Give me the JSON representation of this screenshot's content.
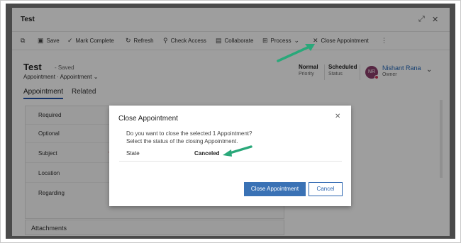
{
  "window": {
    "title": "Test"
  },
  "command_bar": {
    "items": [
      {
        "label": "Save",
        "icon": "save-icon"
      },
      {
        "label": "Mark Complete",
        "icon": "checkmark-icon"
      },
      {
        "label": "Refresh",
        "icon": "refresh-icon"
      },
      {
        "label": "Check Access",
        "icon": "key-person-icon"
      },
      {
        "label": "Collaborate",
        "icon": "teams-icon"
      },
      {
        "label": "Process",
        "icon": "process-icon"
      },
      {
        "label": "Close Appointment",
        "icon": "close-icon"
      }
    ]
  },
  "record": {
    "title": "Test",
    "saved": "- Saved",
    "entity": "Appointment",
    "form": "Appointment",
    "priority_value": "Normal",
    "priority_label": "Priority",
    "status_value": "Scheduled",
    "status_label": "Status",
    "owner_initials": "NR",
    "owner_name": "Nishant Rana",
    "owner_label": "Owner"
  },
  "tabs": [
    {
      "label": "Appointment",
      "active": true
    },
    {
      "label": "Related",
      "active": false
    }
  ],
  "form_fields": [
    {
      "label": "Required"
    },
    {
      "label": "Optional"
    },
    {
      "label": "Subject",
      "required": "*"
    },
    {
      "label": "Location"
    },
    {
      "label": "Regarding"
    }
  ],
  "section": {
    "attachments": "Attachments"
  },
  "modal": {
    "title": "Close Appointment",
    "question": "Do you want to close the selected 1 Appointment?",
    "instruction": "Select the status of the closing Appointment.",
    "state_label": "State",
    "state_value": "Canceled",
    "primary_button": "Close Appointment",
    "secondary_button": "Cancel"
  },
  "colors": {
    "accent": "#3a72b5",
    "arrow": "#2aa87a",
    "avatar": "#8b3e6b"
  }
}
